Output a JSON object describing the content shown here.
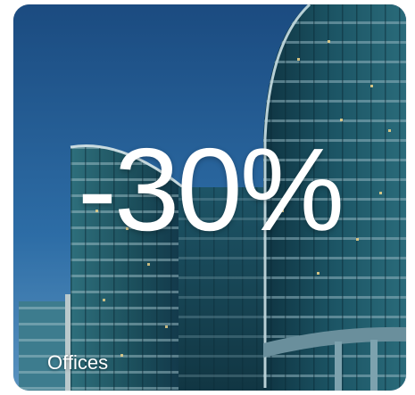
{
  "tile": {
    "discount": "-30%",
    "category": "Offices"
  },
  "colors": {
    "sky_top": "#1f4f86",
    "glass": "#1b4a5a",
    "text": "#ffffff"
  },
  "image": {
    "subject": "glass-office-building-photo"
  }
}
